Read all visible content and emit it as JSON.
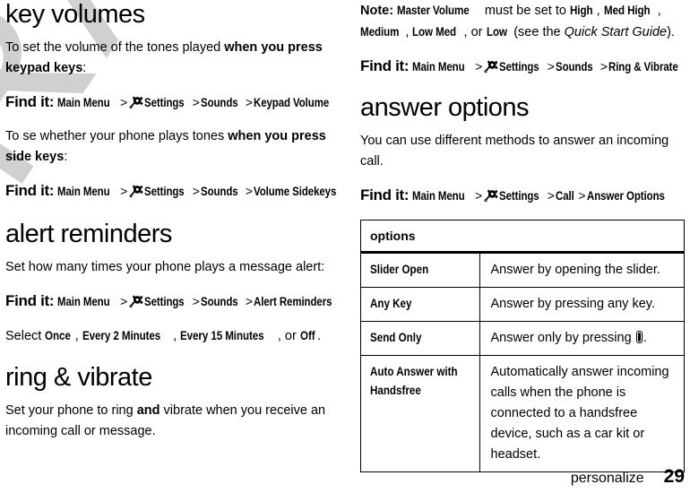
{
  "document": {
    "watermark": "DRAFT",
    "footer": {
      "chapter": "personalize",
      "page_number": "29"
    }
  },
  "icons": {
    "settings_gear": "gear-icon",
    "send_key": "send-key-icon"
  },
  "left_column": {
    "sections": [
      {
        "heading": "key volumes",
        "paragraph_1_pre": "To set the volume of the tones played ",
        "paragraph_1_bold": "when you press keypad keys",
        "paragraph_1_post": ":",
        "findit_label": "Find it:",
        "crumbs": [
          "Main Menu",
          "Settings",
          "Sounds",
          "Keypad Volume"
        ],
        "paragraph_2_pre": "To se whether your phone plays tones ",
        "paragraph_2_bold": "when you press side keys",
        "paragraph_2_post": ":",
        "findit_label_2": "Find it:",
        "crumbs_2": [
          "Main Menu",
          "Settings",
          "Sounds",
          "Volume Sidekeys"
        ]
      },
      {
        "heading": "alert reminders",
        "paragraph": "Set how many times your phone plays a message alert:",
        "findit_label": "Find it:",
        "crumbs": [
          "Main Menu",
          "Settings",
          "Sounds",
          "Alert Reminders"
        ],
        "select_pre": "Select ",
        "select_options": [
          "Once",
          "Every 2 Minutes",
          "Every 15 Minutes"
        ],
        "select_or": "or",
        "select_last": "Off",
        "select_post": "."
      },
      {
        "heading": "ring & vibrate",
        "paragraph_pre": "Set your phone to ring ",
        "paragraph_bold": "and",
        "paragraph_post": " vibrate when you receive an incoming call or message."
      }
    ]
  },
  "right_column": {
    "note": {
      "label": "Note:",
      "term": "Master Volume",
      "text_1": " must be set to ",
      "levels": [
        "High",
        "Med High",
        "Medium",
        "Low Med"
      ],
      "or": ", or ",
      "level_last": "Low",
      "text_2": " (see the ",
      "reference": "Quick Start Guide",
      "text_3": ")."
    },
    "findit_ring": {
      "label": "Find it:",
      "crumbs": [
        "Main Menu",
        "Settings",
        "Sounds",
        "Ring & Vibrate"
      ]
    },
    "section": {
      "heading": "answer options",
      "paragraph": "You can use different methods to answer an incoming call.",
      "findit_label": "Find it:",
      "crumbs": [
        "Main Menu",
        "Settings",
        "Call",
        "Answer Options"
      ]
    },
    "table": {
      "header": "options",
      "rows": [
        {
          "term": "Slider Open",
          "desc": "Answer by opening the slider."
        },
        {
          "term": "Any Key",
          "desc": "Answer by pressing any key."
        },
        {
          "term": "Send Only",
          "desc_pre": "Answer only by pressing ",
          "desc_post": "."
        },
        {
          "term_line1": "Auto Answer with",
          "term_line2": "Handsfree",
          "desc": "Automatically answer incoming calls when the phone is connected to a handsfree device, such as a car kit or headset."
        }
      ]
    }
  }
}
